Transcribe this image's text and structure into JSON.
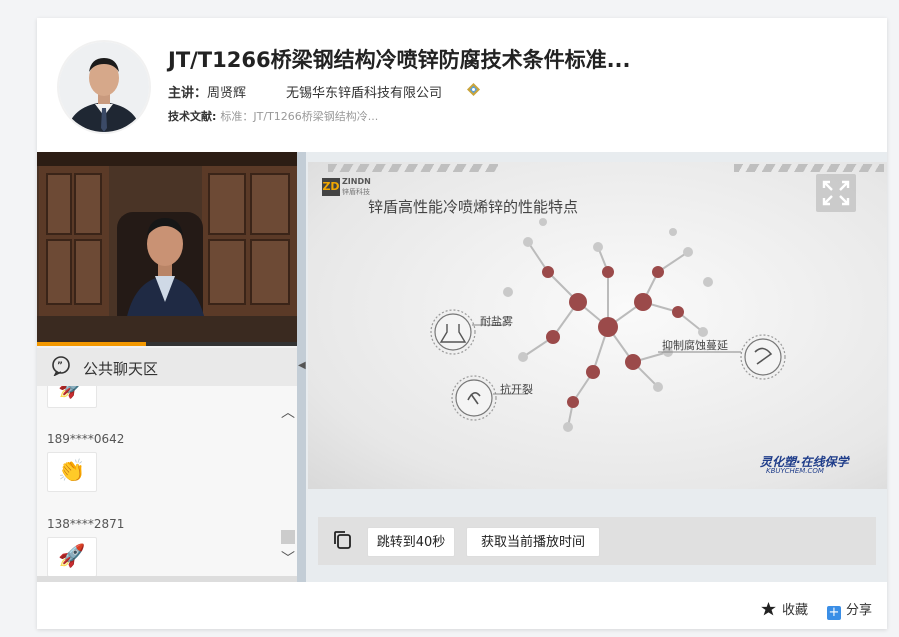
{
  "course": {
    "title": "JT/T1266桥梁钢结构冷喷锌防腐技术条件标准...",
    "presenter_label": "主讲：",
    "presenter": "周贤辉",
    "company": "无锡华东锌盾科技有限公司",
    "docs_label": "技术文献:",
    "docs_value": "标准：JT/T1266桥梁钢结构冷..."
  },
  "video": {
    "progress_fraction": 0.42
  },
  "chat": {
    "title": "公共聊天区",
    "messages": [
      {
        "user": "",
        "emoji": "🚀"
      },
      {
        "user": "189****0642",
        "emoji": "👏"
      },
      {
        "user": "138****2871",
        "emoji": "🚀"
      }
    ]
  },
  "slide": {
    "logo_mark": "ZD",
    "logo_text": "ZINDN",
    "logo_sub": "锌盾科技",
    "title": "锌盾高性能冷喷烯锌的性能特点",
    "features": [
      "耐盐雾",
      "抗开裂",
      "抑制腐蚀蔓延"
    ],
    "brand": "灵化塑·在线保学",
    "brand_sub": "KBUYCHEM.COM"
  },
  "controls": {
    "jump_label": "跳转到40秒",
    "get_time_label": "获取当前播放时间"
  },
  "footer": {
    "favorite_label": "收藏",
    "share_label": "分享"
  },
  "colors": {
    "accent_orange": "#f39800",
    "share_blue": "#3a8ee6",
    "brand_blue": "#1f3d8a",
    "molecule_red": "#9b4a4a"
  }
}
